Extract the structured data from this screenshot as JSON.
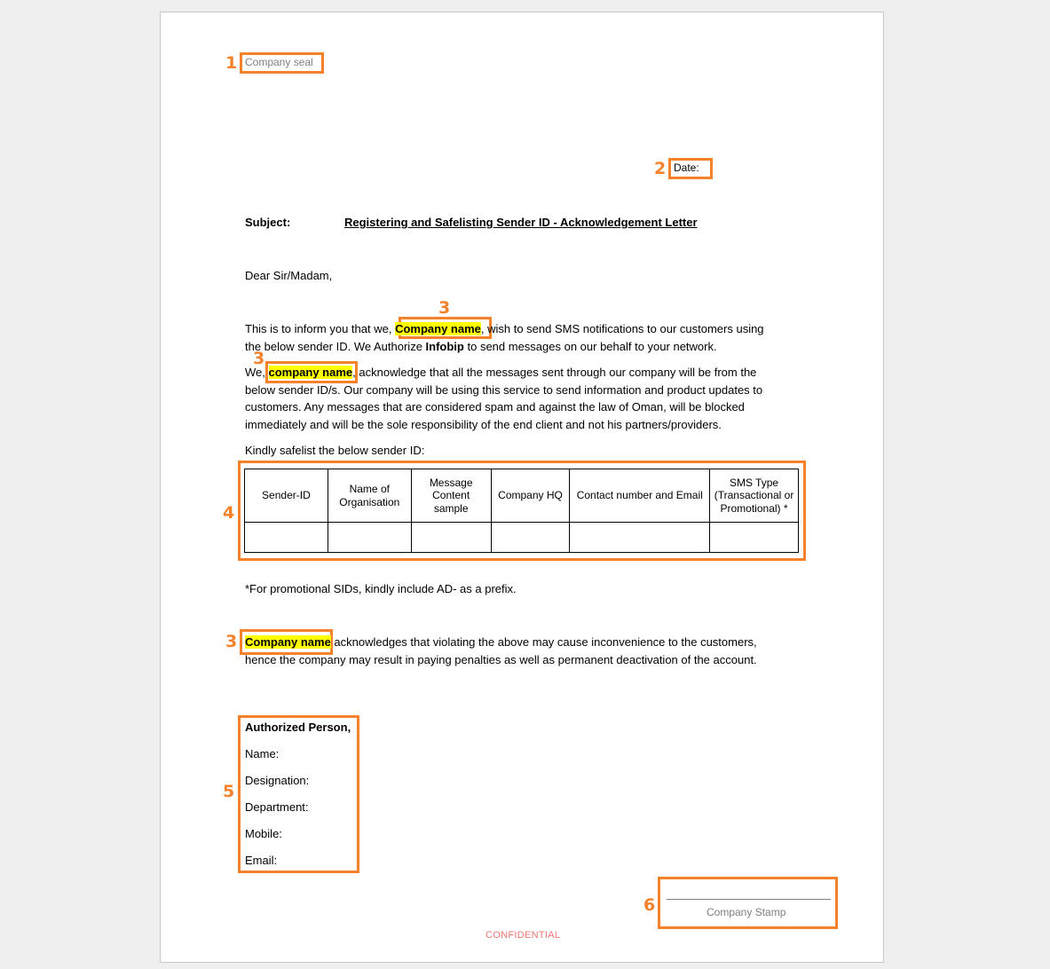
{
  "document": {
    "company_seal": "Company seal",
    "date_label": "Date:",
    "subject_label": "Subject:",
    "subject_text": "Registering and Safelisting Sender ID - Acknowledgement Letter",
    "salutation": "Dear Sir/Madam,",
    "para1": {
      "before": "This is to inform you that we, ",
      "company": "Company name",
      "after_line1": ", wish to send SMS notifications to our customers using",
      "line2_before": "the below sender ID. We Authorize ",
      "brand": "Infobip",
      "line2_after": " to send messages on our behalf to your network."
    },
    "para2": {
      "before": "We, ",
      "company": "company name",
      "after_line1": ", acknowledge that all the messages sent through our company will be from the",
      "line2": "below sender ID/s. Our company will be using this service to send information and product updates to",
      "line3": "customers. Any messages that are considered spam and against the law of Oman, will be blocked",
      "line4": "immediately and will be the sole responsibility of the end client and not his partners/providers."
    },
    "safelist_intro": "Kindly safelist the below sender ID:",
    "table": {
      "headers": [
        "Sender-ID",
        "Name of Organisation",
        "Message Content sample",
        "Company HQ",
        "Contact number and Email",
        "SMS Type (Transactional or Promotional) *"
      ],
      "rows": [
        [
          "",
          "",
          "",
          "",
          "",
          ""
        ]
      ]
    },
    "footnote": "*For promotional SIDs, kindly include AD- as a prefix.",
    "para3": {
      "company": "Company name",
      "after_line1": " acknowledges that violating the above may cause inconvenience to the customers,",
      "line2": "hence the company may result in paying penalties as well as permanent deactivation of the account."
    },
    "authorized": {
      "title": "Authorized Person,",
      "fields": [
        "Name:",
        "Designation:",
        "Department:",
        "Mobile:",
        "Email:"
      ]
    },
    "company_stamp": "Company Stamp",
    "confidential": "CONFIDENTIAL"
  },
  "annotations": {
    "color": "#f5822a",
    "markers": [
      "1",
      "2",
      "3",
      "3",
      "4",
      "3",
      "5",
      "6"
    ]
  },
  "highlight_color": "#ffff00"
}
